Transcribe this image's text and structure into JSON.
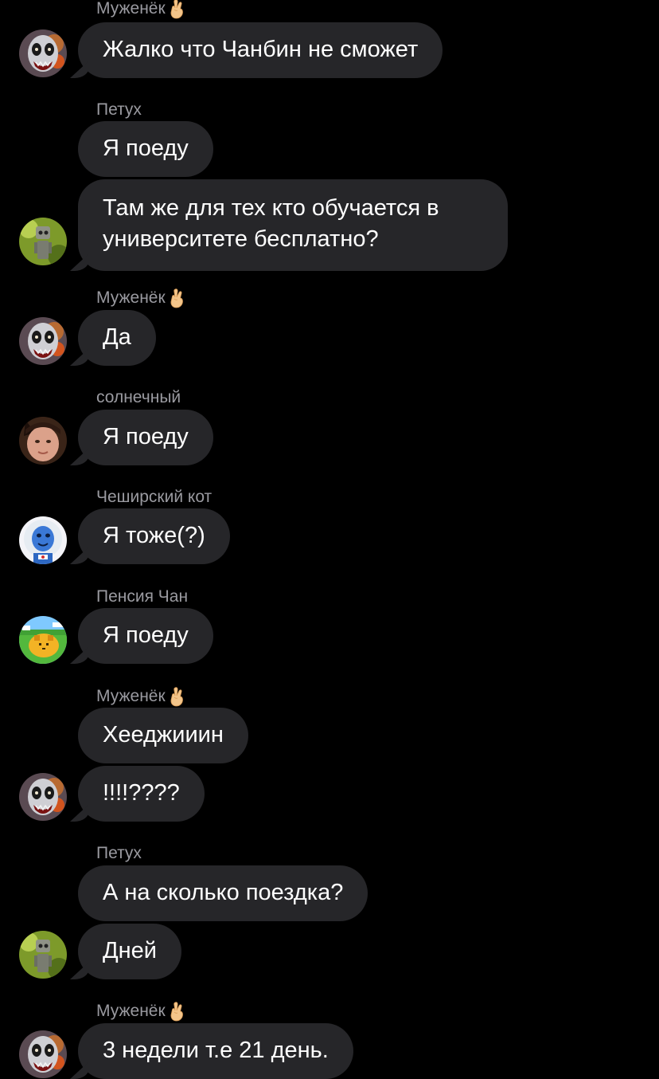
{
  "colors": {
    "background": "#000000",
    "bubble": "#262629",
    "sender_name": "#9a9aa0",
    "message_text": "#ffffff"
  },
  "messages": [
    {
      "sender": "Муженёк",
      "sender_emoji": "crossed-fingers-emoji",
      "text": "Жалко что Чанбин не сможет",
      "avatar": "skull-monster-avatar"
    },
    {
      "sender": "Петух",
      "text": "Я поеду"
    },
    {
      "text_line1": "Там же для тех кто обучается в",
      "text_line2": "университете бесплатно?",
      "avatar": "green-robot-avatar"
    },
    {
      "sender": "Муженёк",
      "sender_emoji": "crossed-fingers-emoji",
      "text": "Да",
      "avatar": "skull-monster-avatar"
    },
    {
      "sender": "солнечный",
      "text": "Я поеду",
      "avatar": "face-photo-avatar"
    },
    {
      "sender": "Чеширский кот",
      "text": "Я тоже(?)",
      "avatar": "blue-astronaut-avatar"
    },
    {
      "sender": "Пенсия Чан",
      "text": "Я поеду",
      "avatar": "pixel-landscape-avatar"
    },
    {
      "sender": "Муженёк",
      "sender_emoji": "crossed-fingers-emoji",
      "text": "Хееджииин"
    },
    {
      "text": "!!!!????",
      "avatar": "skull-monster-avatar"
    },
    {
      "sender": "Петух",
      "text": "А на сколько поездка?"
    },
    {
      "text": "Дней",
      "avatar": "green-robot-avatar"
    },
    {
      "sender": "Муженёк",
      "sender_emoji": "crossed-fingers-emoji",
      "text": "3 недели т.е 21 день.",
      "avatar": "skull-monster-avatar"
    }
  ]
}
